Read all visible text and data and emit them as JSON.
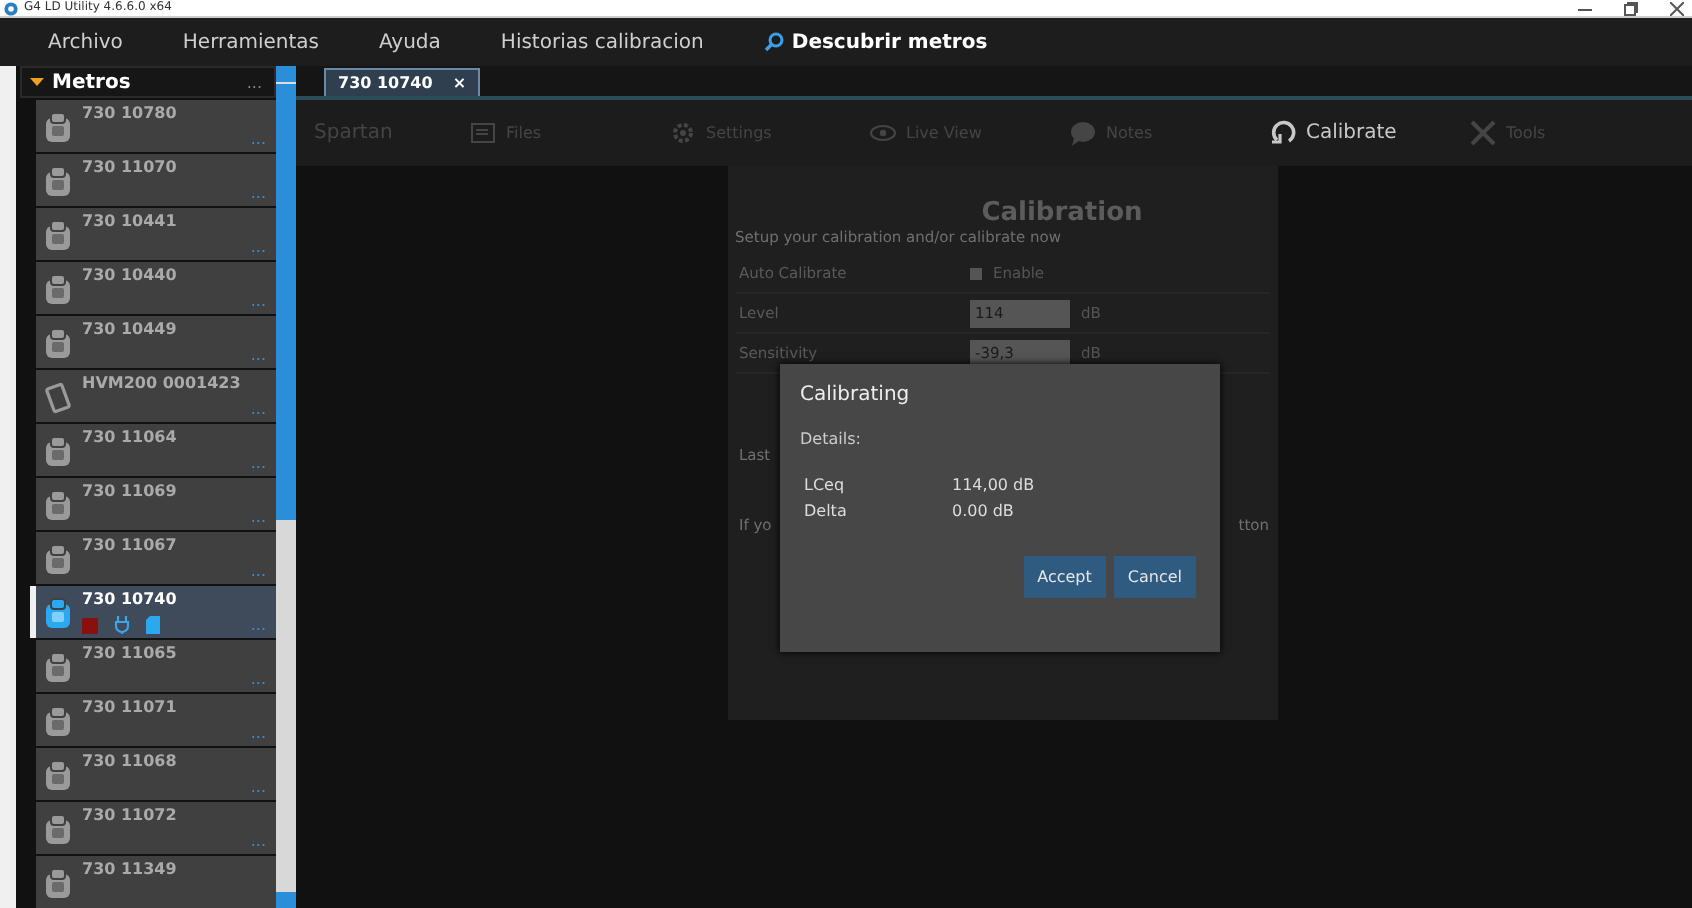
{
  "window": {
    "title": "G4 LD Utility 4.6.6.0 x64"
  },
  "menu": [
    {
      "label": "Archivo",
      "kind": "plain",
      "selected": false
    },
    {
      "label": "Herramientas",
      "kind": "plain",
      "selected": false
    },
    {
      "label": "Ayuda",
      "kind": "plain",
      "selected": false
    },
    {
      "label": "Historias calibracion",
      "kind": "plain",
      "selected": false
    },
    {
      "label": "Descubrir metros",
      "kind": "search",
      "selected": true
    }
  ],
  "sidebar": {
    "title": "Metros",
    "more": "...",
    "items": [
      {
        "name": "730 10780",
        "kind": "meter",
        "selected": false,
        "more": "..."
      },
      {
        "name": "730 11070",
        "kind": "meter",
        "selected": false,
        "more": "..."
      },
      {
        "name": "730 10441",
        "kind": "meter",
        "selected": false,
        "more": "..."
      },
      {
        "name": "730 10440",
        "kind": "meter",
        "selected": false,
        "more": "..."
      },
      {
        "name": "730 10449",
        "kind": "meter",
        "selected": false,
        "more": "..."
      },
      {
        "name": "HVM200 0001423",
        "kind": "hvm",
        "selected": false,
        "more": "..."
      },
      {
        "name": "730 11064",
        "kind": "meter",
        "selected": false,
        "more": "..."
      },
      {
        "name": "730 11069",
        "kind": "meter",
        "selected": false,
        "more": "..."
      },
      {
        "name": "730 11067",
        "kind": "meter",
        "selected": false,
        "more": "..."
      },
      {
        "name": "730 10740",
        "kind": "meter",
        "selected": true,
        "more": "..."
      },
      {
        "name": "730 11065",
        "kind": "meter",
        "selected": false,
        "more": "..."
      },
      {
        "name": "730 11071",
        "kind": "meter",
        "selected": false,
        "more": "..."
      },
      {
        "name": "730 11068",
        "kind": "meter",
        "selected": false,
        "more": "..."
      },
      {
        "name": "730 11072",
        "kind": "meter",
        "selected": false,
        "more": "..."
      },
      {
        "name": "730 11349",
        "kind": "meter",
        "selected": false
      }
    ]
  },
  "tabs": [
    {
      "label": "730 10740",
      "close": "×",
      "selected": true
    }
  ],
  "toolbar": {
    "device": "Spartan",
    "items": [
      {
        "label": "Files",
        "kind": "files",
        "selected": false
      },
      {
        "label": "Settings",
        "kind": "settings",
        "selected": false
      },
      {
        "label": "Live View",
        "kind": "eye",
        "selected": false
      },
      {
        "label": "Notes",
        "kind": "chat",
        "selected": false
      },
      {
        "label": "Calibrate",
        "kind": "calibrate",
        "selected": true
      },
      {
        "label": "Tools",
        "kind": "tools",
        "selected": false
      }
    ]
  },
  "calibration": {
    "title": "Calibration",
    "subtitle": "Setup your calibration and/or calibrate now",
    "rows": [
      {
        "label": "Auto Calibrate",
        "kind": "checkbox",
        "option": "Enable",
        "checked": false
      },
      {
        "label": "Level",
        "kind": "input",
        "value": "114",
        "unit": "dB"
      },
      {
        "label": "Sensitivity",
        "kind": "input",
        "value": "-39,3",
        "unit": "dB"
      }
    ],
    "covered_left": [
      "Last",
      "If yo"
    ],
    "covered_right": "tton"
  },
  "dialog": {
    "title": "Calibrating",
    "details_label": "Details:",
    "results": [
      {
        "name": "LCeq",
        "value": "114,00 dB"
      },
      {
        "name": "Delta",
        "value": "0.00 dB"
      }
    ],
    "buttons": [
      "Accept",
      "Cancel"
    ]
  }
}
